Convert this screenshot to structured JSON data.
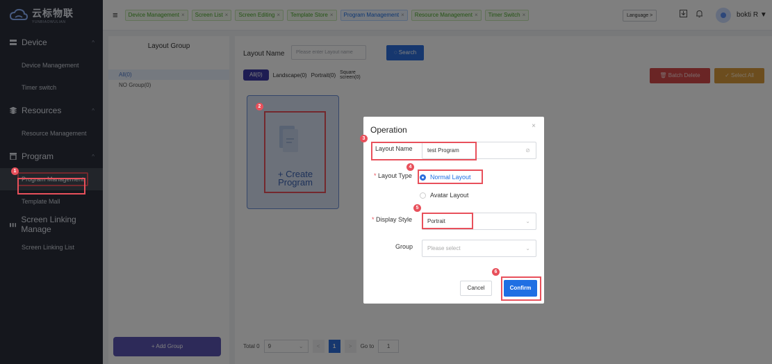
{
  "logo": {
    "cn": "云标物联",
    "en": "YUNBIAOWULIAN"
  },
  "sidebar": {
    "groups": [
      {
        "label": "Device",
        "items": [
          "Device Management",
          "Timer switch"
        ]
      },
      {
        "label": "Resources",
        "items": [
          "Resource Management"
        ]
      },
      {
        "label": "Program",
        "items": [
          "Program Management",
          "Template Mall"
        ]
      },
      {
        "label": "Screen Linking Manage",
        "items": [
          "Screen Linking List"
        ]
      }
    ]
  },
  "topbar": {
    "tabs": [
      {
        "label": "Device Management",
        "close": "×"
      },
      {
        "label": "Screen List",
        "close": "×"
      },
      {
        "label": "Screen Editing",
        "close": "×"
      },
      {
        "label": "Template Store",
        "close": "×"
      },
      {
        "label": "Program Management",
        "close": "×"
      },
      {
        "label": "Resource Management",
        "close": "×"
      },
      {
        "label": "Timer Switch",
        "close": "×"
      }
    ],
    "language": "Language >",
    "username": "bokti R ▼"
  },
  "layout_group": {
    "title": "Layout Group",
    "items": [
      "All(0)",
      "NO Group(0)"
    ],
    "add_button": "+ Add Group"
  },
  "main": {
    "layout_name_label": "Layout Name",
    "layout_name_placeholder": "Please enter Layout name",
    "search_button": "◌ Search",
    "filters": {
      "all": "All(0)",
      "landscape": "Landscape(0)",
      "portrait": "Portrait(0)",
      "square_line1": "Square",
      "square_line2": "screen(0)"
    },
    "batch_delete": "🗑 Batch Delete",
    "select_all": "✓ Select All",
    "create_line1": "+ Create",
    "create_line2": "Program"
  },
  "pager": {
    "total": "Total 0",
    "page_size": "9",
    "current_page": "1",
    "goto_label": "Go to",
    "goto_value": "1",
    "prev": "<",
    "next": ">"
  },
  "dialog": {
    "title": "Operation",
    "close": "×",
    "layout_name_label": "Layout Name",
    "layout_name_value": "test Program",
    "layout_type_label": "Layout Type",
    "layout_type_options": [
      "Normal Layout",
      "Avatar Layout"
    ],
    "display_style_label": "Display Style",
    "display_style_value": "Portrait",
    "group_label": "Group",
    "group_placeholder": "Please select",
    "cancel": "Cancel",
    "confirm": "Confirm",
    "required_mark": "*"
  },
  "steps": [
    "1",
    "2",
    "3",
    "4",
    "5",
    "6"
  ],
  "colors": {
    "sidebar_bg": "#2b2f3a",
    "accent_blue": "#1f6fe3",
    "highlight_red": "#e8505b",
    "purple": "#3d3aa6",
    "batch_red": "#d54a4a",
    "select_orange": "#d99a3c"
  }
}
